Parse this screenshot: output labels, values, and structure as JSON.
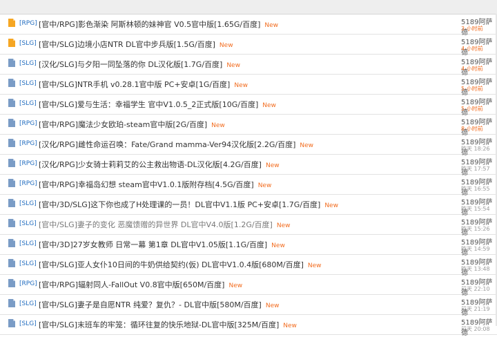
{
  "threads": [
    {
      "tag": "[RPG]",
      "title": "[官中/RPG]影色渐染 阿斯林顿的妹神官 V0.5官中版[1.65G/百度]",
      "new": "New",
      "author": "5189阿萨德",
      "time": "3 小时前",
      "icon": "hot",
      "time_style": "orange"
    },
    {
      "tag": "[SLG]",
      "title": "[官中/SLG]边境小店NTR DL官中步兵版[1.5G/百度]",
      "new": "New",
      "author": "5189阿萨德",
      "time": "4 小时前",
      "icon": "hot",
      "time_style": "orange"
    },
    {
      "tag": "[SLG]",
      "title": "[汉化/SLG]与夕阳一同坠落的你 DL汉化版[1.7G/百度]",
      "new": "New",
      "author": "5189阿萨德",
      "time": "4 小时前",
      "icon": "doc",
      "time_style": "orange"
    },
    {
      "tag": "[SLG]",
      "title": "[官中/SLG]NTR手机 v0.28.1官中版 PC+安卓[1G/百度]",
      "new": "New",
      "author": "5189阿萨德",
      "time": "5 小时前",
      "icon": "doc",
      "time_style": "orange"
    },
    {
      "tag": "[SLG]",
      "title": "[官中/SLG]爱与生活：幸福学生 官中V1.0.5_2正式版[10G/百度]",
      "new": "New",
      "author": "5189阿萨德",
      "time": "5 小时前",
      "icon": "doc",
      "time_style": "orange"
    },
    {
      "tag": "[RPG]",
      "title": "[官中/RPG]魔法少女欧珀-steam官中版[2G/百度]",
      "new": "New",
      "author": "5189阿萨德",
      "time": "8 小时前",
      "icon": "doc",
      "time_style": "orange"
    },
    {
      "tag": "[RPG]",
      "title": "[汉化/RPG]雌性命运召唤：Fate/Grand mamma-Ver94汉化版[2.2G/百度]",
      "new": "New",
      "author": "5189阿萨德",
      "time": "昨天 18:26",
      "icon": "doc",
      "time_style": "gray"
    },
    {
      "tag": "[RPG]",
      "title": "[汉化/RPG]少女骑士莉莉艾的公主救出物语-DL汉化版[4.2G/百度]",
      "new": "New",
      "author": "5189阿萨德",
      "time": "昨天 17:57",
      "icon": "doc",
      "time_style": "gray"
    },
    {
      "tag": "[RPG]",
      "title": "[官中/RPG]幸福岛幻想 steam官中V1.0.1版附存档[4.5G/百度]",
      "new": "New",
      "author": "5189阿萨德",
      "time": "昨天 16:55",
      "icon": "doc",
      "time_style": "gray"
    },
    {
      "tag": "[SLG]",
      "title": "[官中/3D/SLG]这下你也成了H处理课的一员！DL官中V1.1版 PC+安卓[1.7G/百度]",
      "new": "New",
      "author": "5189阿萨德",
      "time": "昨天 15:54",
      "icon": "doc",
      "time_style": "gray"
    },
    {
      "tag": "[SLG]",
      "title": "[官中/SLG]妻子的变化 恶魔馈赠的异世界 DL官中V4.0版[1.2G/百度]",
      "new": "New",
      "author": "5189阿萨德",
      "time": "昨天 15:26",
      "icon": "doc",
      "time_style": "gray",
      "visited": true
    },
    {
      "tag": "[SLG]",
      "title": "[官中/3D]27岁女教师 日常一幕 第1章 DL官中V1.05版[1.1G/百度]",
      "new": "New",
      "author": "5189阿萨德",
      "time": "昨天 14:59",
      "icon": "doc",
      "time_style": "gray"
    },
    {
      "tag": "[SLG]",
      "title": "[官中/SLG]亚人女仆10日间的牛奶供给契约(仮) DL官中V1.0.4版[680M/百度]",
      "new": "New",
      "author": "5189阿萨德",
      "time": "昨天 13:48",
      "icon": "doc",
      "time_style": "gray"
    },
    {
      "tag": "[RPG]",
      "title": "[官中/RPG]辐射同人-FallOut V0.8官中版[650M/百度]",
      "new": "New",
      "author": "5189阿萨德",
      "time": "前天 22:10",
      "icon": "doc",
      "time_style": "gray"
    },
    {
      "tag": "[SLG]",
      "title": "[官中/SLG]妻子是自愿NTR 纯爱？复仇？- DL官中版[580M/百度]",
      "new": "New",
      "author": "5189阿萨德",
      "time": "前天 21:19",
      "icon": "doc",
      "time_style": "gray"
    },
    {
      "tag": "[SLG]",
      "title": "[官中/SLG]末班车的牢笼：循环往复的快乐地狱-DL官中版[325M/百度]",
      "new": "New",
      "author": "5189阿萨德",
      "time": "前天 20:08",
      "icon": "doc",
      "time_style": "gray"
    }
  ],
  "colors": {
    "hot_icon": "#f5a623",
    "doc_icon": "#7a9cc6",
    "tag": "#1f6bbf",
    "new": "#f26b1d"
  }
}
